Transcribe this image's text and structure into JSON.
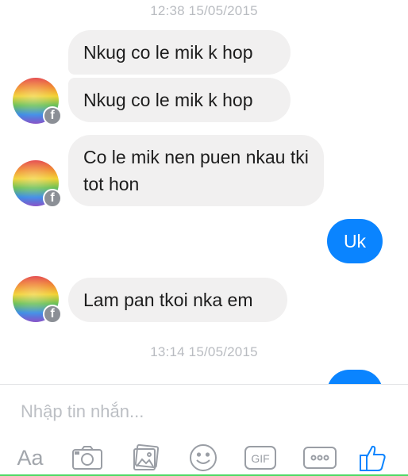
{
  "timestamps": [
    "12:38 15/05/2015",
    "13:14 15/05/2015"
  ],
  "incoming": [
    "Nkug co le mik k hop",
    "Nkug co le mik k hop",
    "Co le mik nen puen nkau tki tot hon",
    "Lam pan tkoi nka em"
  ],
  "outgoing": [
    "Uk",
    ""
  ],
  "avatar_badge": "f",
  "composer": {
    "placeholder": "Nhập tin nhắn...",
    "aa_label": "Aa",
    "gif_label": "GIF"
  },
  "icons": {
    "camera": "camera-icon",
    "gallery": "gallery-icon",
    "emoji": "emoji-icon",
    "gif": "gif-icon",
    "more": "more-icon",
    "like": "thumbs-up-icon"
  },
  "colors": {
    "outgoing_bubble": "#0a84ff",
    "incoming_bubble": "#f1f0f0",
    "timestamp": "#b9bcc1",
    "like": "#0a84ff"
  }
}
